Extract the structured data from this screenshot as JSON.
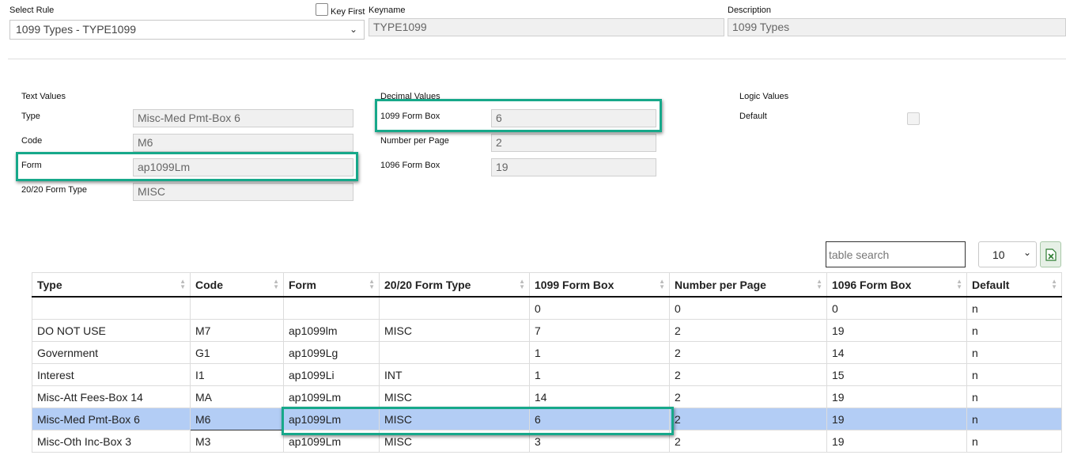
{
  "header": {
    "select_rule_label": "Select Rule",
    "select_rule_value": "1099 Types - TYPE1099",
    "key_first_label": "Key First",
    "keyname_label": "Keyname",
    "keyname_value": "TYPE1099",
    "description_label": "Description",
    "description_value": "1099 Types"
  },
  "text_values": {
    "section_label": "Text Values",
    "fields": [
      {
        "label": "Type",
        "value": "Misc-Med Pmt-Box 6"
      },
      {
        "label": "Code",
        "value": "M6"
      },
      {
        "label": "Form",
        "value": "ap1099Lm"
      },
      {
        "label": "20/20 Form Type",
        "value": "MISC"
      }
    ]
  },
  "decimal_values": {
    "section_label": "Decimal Values",
    "fields": [
      {
        "label": "1099 Form Box",
        "value": "6"
      },
      {
        "label": "Number per Page",
        "value": "2"
      },
      {
        "label": "1096 Form Box",
        "value": "19"
      }
    ]
  },
  "logic_values": {
    "section_label": "Logic Values",
    "fields": [
      {
        "label": "Default",
        "checked": false
      }
    ]
  },
  "table_controls": {
    "search_placeholder": "table search",
    "page_size": "10",
    "export_icon": "excel-export-icon"
  },
  "table": {
    "columns": [
      "Type",
      "Code",
      "Form",
      "20/20 Form Type",
      "1099 Form Box",
      "Number per Page",
      "1096 Form Box",
      "Default"
    ],
    "rows": [
      [
        "",
        "",
        "",
        "",
        "0",
        "0",
        "0",
        "n"
      ],
      [
        "DO NOT USE",
        "M7",
        "ap1099lm",
        "MISC",
        "7",
        "2",
        "19",
        "n"
      ],
      [
        "Government",
        "G1",
        "ap1099Lg",
        "",
        "1",
        "2",
        "14",
        "n"
      ],
      [
        "Interest",
        "I1",
        "ap1099Li",
        "INT",
        "1",
        "2",
        "15",
        "n"
      ],
      [
        "Misc-Att Fees-Box 14",
        "MA",
        "ap1099Lm",
        "MISC",
        "14",
        "2",
        "19",
        "n"
      ],
      [
        "Misc-Med Pmt-Box 6",
        "M6",
        "ap1099Lm",
        "MISC",
        "6",
        "2",
        "19",
        "n"
      ],
      [
        "Misc-Oth Inc-Box 3",
        "M3",
        "ap1099Lm",
        "MISC",
        "3",
        "2",
        "19",
        "n"
      ]
    ],
    "selected_row": 5
  },
  "colors": {
    "highlight": "#17a88a",
    "selected_row": "#b3cdf5"
  }
}
